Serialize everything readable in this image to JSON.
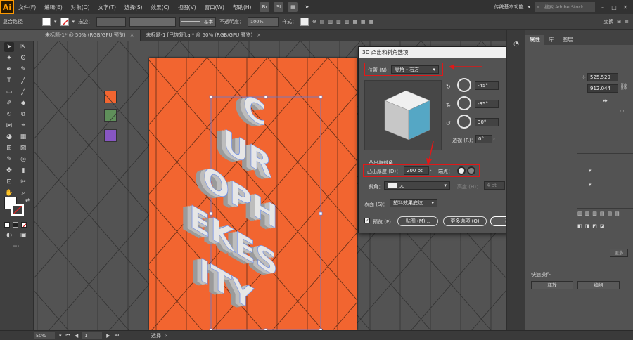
{
  "app": {
    "logo": "Ai"
  },
  "menubar": {
    "items": [
      "文件(F)",
      "编辑(E)",
      "对象(O)",
      "文字(T)",
      "选择(S)",
      "效果(C)",
      "视图(V)",
      "窗口(W)",
      "帮助(H)"
    ],
    "badges": [
      "Br",
      "St"
    ],
    "workspace": "传统基本功能",
    "search_placeholder": "搜索 Adobe Stock"
  },
  "controlbar": {
    "object_type": "复合路径",
    "stroke_label": "描边：",
    "brush_label": "基本",
    "opacity_label": "不透明度：",
    "opacity_value": "100%",
    "style_label": "样式：",
    "transform_label": "变换"
  },
  "tabs": [
    {
      "label": "未标题-1* @ 50% (RGB/GPU 预览)",
      "close": "×"
    },
    {
      "label": "未标题-1 [已恢复].ai* @ 50% (RGB/GPU 预览)",
      "close": "×"
    }
  ],
  "dialog": {
    "title": "3D 凸出和斜角选项",
    "position_label": "位置 (N)：",
    "position_value": "等角 - 右方",
    "angle_x": "-45°",
    "angle_y": "-35°",
    "angle_z": "30°",
    "perspective_label": "透视 (R)：",
    "perspective_value": "0°",
    "section_extrude": "凸出与斜角",
    "depth_label": "凸出厚度 (D)：",
    "depth_value": "200 pt",
    "cap_label": "端点：",
    "bevel_label": "斜角：",
    "bevel_value": "无",
    "height_label": "高度 (H)：",
    "height_value": "4 pt",
    "surface_label": "表面 (S)：",
    "surface_value": "塑料效果底纹",
    "preview_label": "预览 (P)",
    "map_button": "贴图 (M)...",
    "more_button": "更多选项 (O)",
    "ok_button": "确定",
    "cancel_button": "取消"
  },
  "rpanel": {
    "tabs": [
      "属性",
      "库",
      "图层"
    ],
    "x_value": "525.529",
    "y_value": "912.044",
    "quick_actions_label": "快速操作",
    "release_button": "释放",
    "edit_button": "编组",
    "more_button": "更多"
  },
  "artwork_letters": [
    "C",
    "UR",
    "OPH",
    "EKES",
    "ITY"
  ],
  "statusbar": {
    "zoom": "50%",
    "page": "1",
    "mode": "选择"
  },
  "colors": {
    "artboard": "#f26530",
    "swatch_orange": "#f26530",
    "swatch_green": "#5f8f5a",
    "swatch_purple": "#8756c2",
    "cube_top": "#f0f0f0",
    "cube_left": "#c7c7c7",
    "cube_right": "#55a7c5",
    "highlight": "#e01818"
  }
}
